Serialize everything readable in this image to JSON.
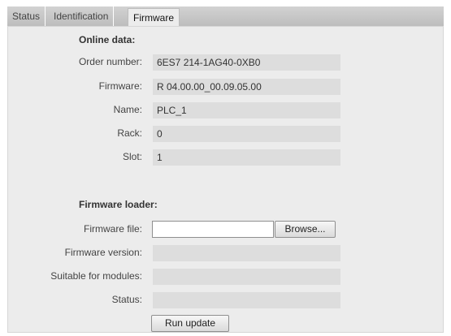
{
  "tabs": [
    {
      "label": "Status"
    },
    {
      "label": "Identification"
    },
    {
      "label": "Firmware"
    }
  ],
  "online": {
    "title": "Online data:",
    "rows": [
      {
        "label": "Order number:",
        "value": "6ES7 214-1AG40-0XB0"
      },
      {
        "label": "Firmware:",
        "value": "R 04.00.00_00.09.05.00"
      },
      {
        "label": "Name:",
        "value": "PLC_1"
      },
      {
        "label": "Rack:",
        "value": "0"
      },
      {
        "label": "Slot:",
        "value": "1"
      }
    ]
  },
  "loader": {
    "title": "Firmware loader:",
    "file_label": "Firmware file:",
    "file_value": "",
    "browse_label": "Browse...",
    "version_label": "Firmware version:",
    "version_value": "",
    "modules_label": "Suitable for modules:",
    "modules_value": "",
    "status_label": "Status:",
    "status_value": "",
    "run_label": "Run update"
  }
}
